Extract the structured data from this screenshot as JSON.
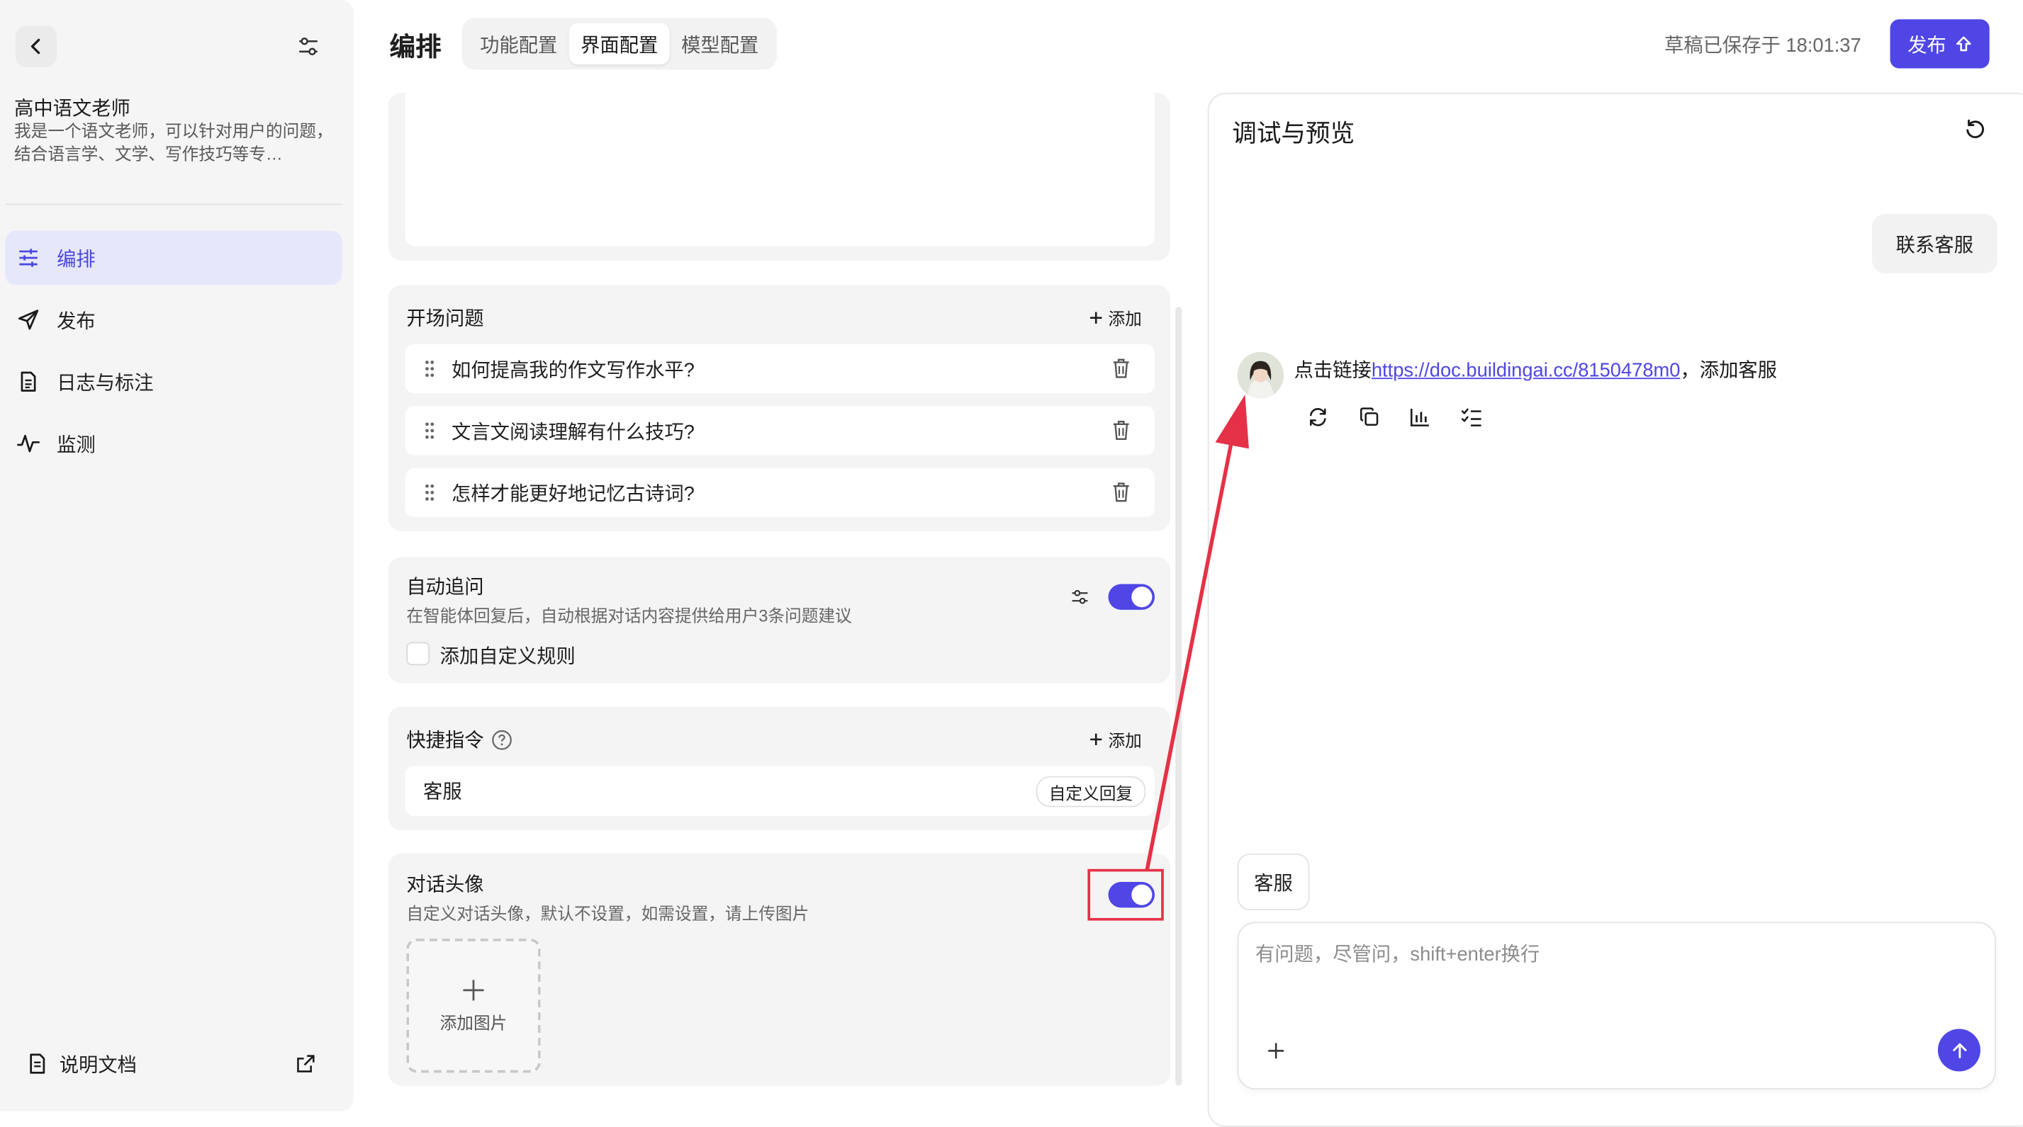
{
  "sidebar": {
    "agent_name": "高中语文老师",
    "agent_desc": "我是一个语文老师，可以针对用户的问题，结合语言学、文学、写作技巧等专…",
    "nav": [
      {
        "label": "编排",
        "icon": "sliders-icon",
        "active": true
      },
      {
        "label": "发布",
        "icon": "send-icon",
        "active": false
      },
      {
        "label": "日志与标注",
        "icon": "document-icon",
        "active": false
      },
      {
        "label": "监测",
        "icon": "activity-icon",
        "active": false
      }
    ],
    "docs_label": "说明文档"
  },
  "header": {
    "title": "编排",
    "tabs": [
      "功能配置",
      "界面配置",
      "模型配置"
    ],
    "active_tab": "界面配置",
    "saved_text": "草稿已保存于 18:01:37",
    "publish_label": "发布"
  },
  "opening": {
    "title": "开场问题",
    "add_label": "添加",
    "questions": [
      "如何提高我的作文写作水平?",
      "文言文阅读理解有什么技巧?",
      "怎样才能更好地记忆古诗词?"
    ]
  },
  "followup": {
    "title": "自动追问",
    "desc": "在智能体回复后，自动根据对话内容提供给用户3条问题建议",
    "custom_rule_label": "添加自定义规则",
    "enabled": true
  },
  "shortcuts": {
    "title": "快捷指令",
    "add_label": "添加",
    "items": [
      {
        "name": "客服",
        "tag": "自定义回复"
      }
    ]
  },
  "avatar_setting": {
    "title": "对话头像",
    "desc": "自定义对话头像，默认不设置，如需设置，请上传图片",
    "upload_label": "添加图片",
    "enabled": true
  },
  "preview": {
    "title": "调试与预览",
    "user_message": "联系客服",
    "bot_prefix": "点击链接",
    "bot_link": "https://doc.buildingai.cc/8150478m0",
    "bot_suffix": "，添加客服",
    "shortcut_chip": "客服",
    "input_placeholder": "有问题，尽管问，shift+enter换行"
  },
  "colors": {
    "accent": "#4f46e5",
    "annotation": "#e53147"
  }
}
